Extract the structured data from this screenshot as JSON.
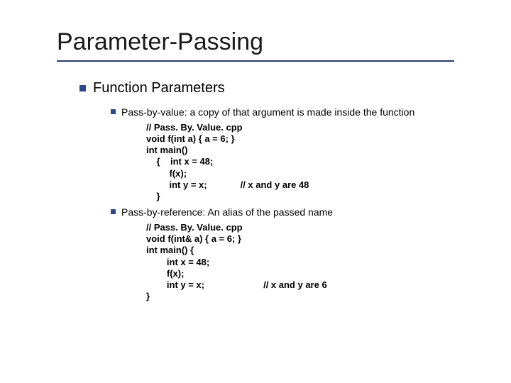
{
  "title": "Parameter-Passing",
  "section": "Function Parameters",
  "items": [
    {
      "label": "Pass-by-value: a copy of that argument is made inside the function",
      "code": {
        "l1": "// Pass. By. Value. cpp",
        "l2": "void f(int a) { a = 6; }",
        "l3": "int main()",
        "l4": "    {    int x = 48;",
        "l5": "         f(x);",
        "l6": "         int y = x;",
        "l6c": "// x and y are 48",
        "l7": "    }"
      }
    },
    {
      "label": "Pass-by-reference: An alias of the passed name",
      "code": {
        "l1": "// Pass. By. Value. cpp",
        "l2": "void f(int& a) { a = 6; }",
        "l3": "int main() {",
        "l4": "        int x = 48;",
        "l5": "        f(x);",
        "l6": "        int y = x;",
        "l6c": "// x and y are 6",
        "l7": "}"
      }
    }
  ]
}
